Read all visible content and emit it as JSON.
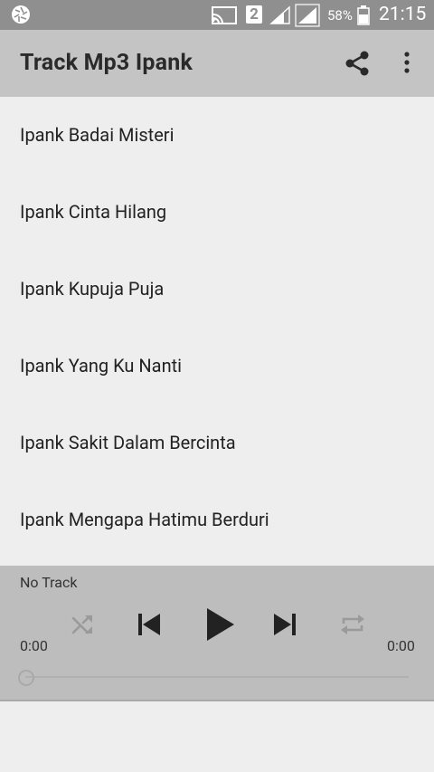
{
  "status_bar": {
    "sim_number": "2",
    "battery_percent": "58%",
    "time": "21:15",
    "icons": [
      "aperture-icon",
      "cast-icon",
      "signal-icon",
      "battery-icon"
    ]
  },
  "app_bar": {
    "title": "Track Mp3 Ipank",
    "actions": [
      "share-icon",
      "more-vert-icon"
    ]
  },
  "tracks": [
    "Ipank Badai Misteri",
    "Ipank Cinta Hilang",
    "Ipank Kupuja Puja",
    "Ipank Yang Ku Nanti",
    "Ipank Sakit Dalam Bercinta",
    "Ipank Mengapa Hatimu Berduri"
  ],
  "player": {
    "now_playing": "No Track",
    "current_time": "0:00",
    "total_time": "0:00",
    "progress": 0,
    "controls": [
      "shuffle-icon",
      "skip-previous-icon",
      "play-icon",
      "skip-next-icon",
      "repeat-icon"
    ]
  }
}
